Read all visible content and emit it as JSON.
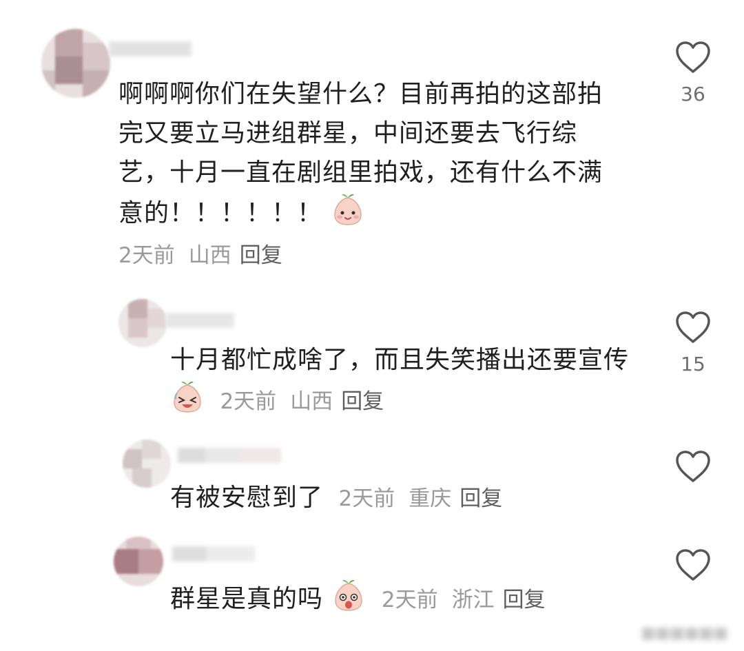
{
  "comments": [
    {
      "text": "啊啊啊你们在失望什么？目前再拍的这部拍完又要立马进组群星，中间还要去飞行综艺，十月一直在剧组里拍戏，还有什么不满意的！！！！！！",
      "time": "2天前",
      "location": "山西",
      "reply_label": "回复",
      "likes": "36",
      "emoji": "smiling-peach-emoji"
    },
    {
      "text": "十月都忙成啥了，而且失笑播出还要宣传",
      "time": "2天前",
      "location": "山西",
      "reply_label": "回复",
      "likes": "15",
      "emoji": "crying-peach-emoji"
    },
    {
      "text": "有被安慰到了",
      "time": "2天前",
      "location": "重庆",
      "reply_label": "回复",
      "likes": "",
      "emoji": ""
    },
    {
      "text": "群星是真的吗",
      "time": "2天前",
      "location": "浙江",
      "reply_label": "回复",
      "likes": "",
      "emoji": "surprised-peach-emoji"
    }
  ],
  "icons": {
    "like": "heart-outline-icon"
  },
  "colors": {
    "text": "#1f1f1f",
    "meta": "#9a9a9a",
    "reply": "#5f5f5f",
    "icon": "#555555"
  }
}
